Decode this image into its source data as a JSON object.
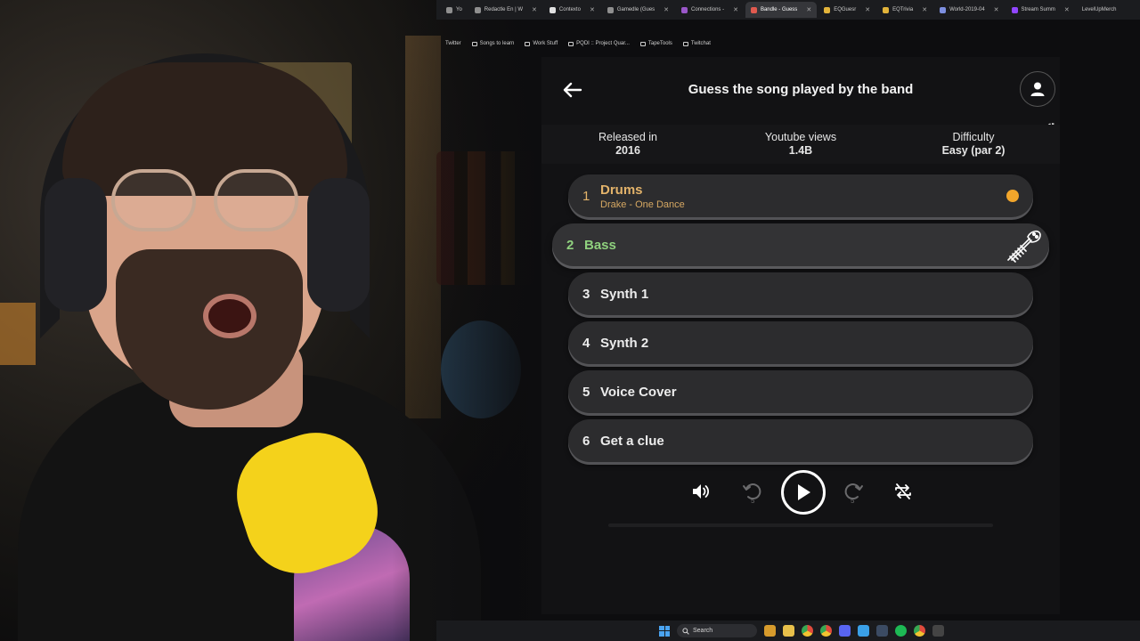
{
  "browser": {
    "tabs": [
      {
        "label": "Yo",
        "active": false
      },
      {
        "label": "Redactle En | W",
        "active": false
      },
      {
        "label": "Contexto",
        "active": false
      },
      {
        "label": "Gamedle (Gues",
        "active": false
      },
      {
        "label": "Connections -",
        "active": false
      },
      {
        "label": "Bandle - Guess",
        "active": true
      },
      {
        "label": "EQGuesr",
        "active": false
      },
      {
        "label": "EQTrivia",
        "active": false
      },
      {
        "label": "World-2019-04",
        "active": false
      },
      {
        "label": "Stream Summ",
        "active": false
      },
      {
        "label": "LevelUpMerch",
        "active": false
      }
    ],
    "bookmarks": [
      "Twitter",
      "Songs to learn",
      "Work Stuff",
      "PQDI :: Project Quar...",
      "TapeTools",
      "Twitchat"
    ]
  },
  "game": {
    "title": "Guess the song played by the band",
    "stats": [
      {
        "label": "Released in",
        "value": "2016"
      },
      {
        "label": "Youtube views",
        "value": "1.4B"
      },
      {
        "label": "Difficulty",
        "value": "Easy (par 2)"
      }
    ],
    "rows": [
      {
        "num": "1",
        "label": "Drums",
        "sub": "Drake - One Dance"
      },
      {
        "num": "2",
        "label": "Bass"
      },
      {
        "num": "3",
        "label": "Synth 1"
      },
      {
        "num": "4",
        "label": "Synth 2"
      },
      {
        "num": "5",
        "label": "Voice Cover"
      },
      {
        "num": "6",
        "label": "Get a clue"
      }
    ],
    "controls": {
      "rewind_seconds": "5",
      "forward_seconds": "5"
    },
    "colors": {
      "revealed": "#e3b36a",
      "active": "#8fd17e",
      "dot": "#f2a62b"
    }
  },
  "taskbar": {
    "search_label": "Search",
    "apps": [
      "files-icon",
      "chrome-icon",
      "chrome-alt-icon",
      "discord-icon",
      "network-icon",
      "steam-icon",
      "spotify-icon",
      "chrome-dev-icon",
      "stream-icon"
    ]
  }
}
